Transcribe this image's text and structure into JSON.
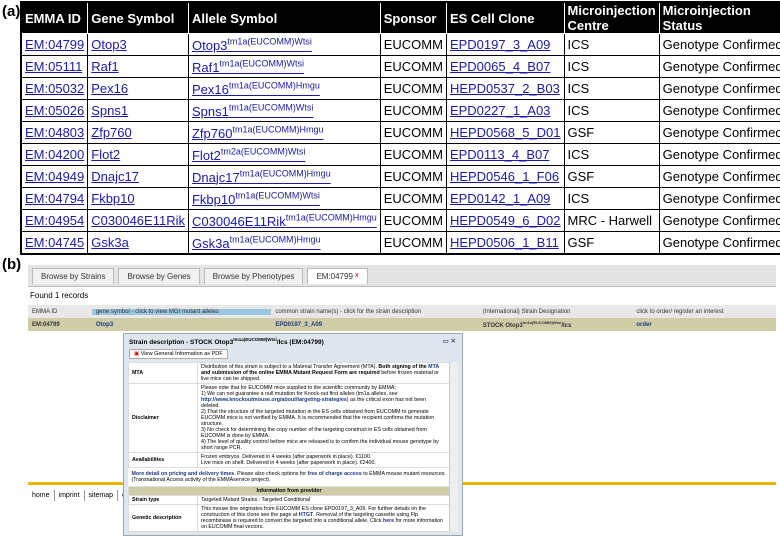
{
  "panel_a": {
    "label": "(a)",
    "headers": [
      "EMMA ID",
      "Gene Symbol",
      "Allele Symbol",
      "Sponsor",
      "ES Cell Clone",
      "Microinjection Centre",
      "Microinjection Status"
    ],
    "rows": [
      [
        "EM:04799",
        "Otop3",
        "Otop3",
        "tm1a(EUCOMM)Wtsi",
        "EUCOMM",
        "EPD0197_3_A09",
        "ICS",
        "Genotype Confirmed"
      ],
      [
        "EM:05111",
        "Raf1",
        "Raf1",
        "tm1a(EUCOMM)Wtsi",
        "EUCOMM",
        "EPD0065_4_B07",
        "ICS",
        "Genotype Confirmed"
      ],
      [
        "EM:05032",
        "Pex16",
        "Pex16",
        "tm1a(EUCOMM)Hmgu",
        "EUCOMM",
        "HEPD0537_2_B03",
        "ICS",
        "Genotype Confirmed"
      ],
      [
        "EM:05026",
        "Spns1",
        "Spns1",
        "tm1a(EUCOMM)Wtsi",
        "EUCOMM",
        "EPD0227_1_A03",
        "ICS",
        "Genotype Confirmed"
      ],
      [
        "EM:04803",
        "Zfp760",
        "Zfp760",
        "tm1a(EUCOMM)Hmgu",
        "EUCOMM",
        "HEPD0568_5_D01",
        "GSF",
        "Genotype Confirmed"
      ],
      [
        "EM:04200",
        "Flot2",
        "Flot2",
        "tm2a(EUCOMM)Wtsi",
        "EUCOMM",
        "EPD0113_4_B07",
        "ICS",
        "Genotype Confirmed"
      ],
      [
        "EM:04949",
        "Dnajc17",
        "Dnajc17",
        "tm1a(EUCOMM)Hmgu",
        "EUCOMM",
        "HEPD0546_1_F06",
        "GSF",
        "Genotype Confirmed"
      ],
      [
        "EM:04794",
        "Fkbp10",
        "Fkbp10",
        "tm1a(EUCOMM)Wtsi",
        "EUCOMM",
        "EPD0142_1_A09",
        "ICS",
        "Genotype Confirmed"
      ],
      [
        "EM:04954",
        "C030046E11Rik",
        "C030046E11Rik",
        "tm1a(EUCOMM)Hmgu",
        "EUCOMM",
        "HEPD0549_6_D02",
        "MRC - Harwell",
        "Genotype Confirmed"
      ],
      [
        "EM:04745",
        "Gsk3a",
        "Gsk3a",
        "tm1a(EUCOMM)Hmgu",
        "EUCOMM",
        "HEPD0506_1_B11",
        "GSF",
        "Genotype Confirmed"
      ]
    ]
  },
  "panel_b": {
    "label": "(b)",
    "tabs": [
      "Browse by Strains",
      "Browse by Genes",
      "Browse by Phenotypes",
      "EM:04799"
    ],
    "close": "x",
    "found": "Found 1 records",
    "grid_headers": [
      "EMMA ID",
      "gene symbol - click to view MGI mutant alleles",
      "common strain name(s) - click for the strain description",
      "(International) Strain Designation",
      "click to order/ register an interest"
    ],
    "grid_row": {
      "id": "EM:04799",
      "gene": "Otop3",
      "clone": "EPD0197_3_A09",
      "desig": "STOCK Otop3",
      "sup": "tm1a(EUCOMM)Wtsi",
      "desig_end": "/Ics",
      "order": "order"
    },
    "popup": {
      "title_a": "Strain description - STOCK Otop3",
      "title_sup": "tm1a(EUCOMM)Wtsi",
      "title_b": "/Ics (EM:04799)",
      "pdf": "View General Information as PDF",
      "mta_k": "MTA",
      "mta_1": "Distribution of this strain is subject to a Material Transfer Agreement (MTA). ",
      "mta_2": "Both signing of the ",
      "mta_3": "MTA",
      "mta_4": " and submission of the online EMMA Mutant Request Form are required",
      "mta_5": " before frozen material or live mice can be shipped.",
      "disc_k": "Disclaimer",
      "disc_1": "Please note that for EUCOMM mice supplied to the scientific community by EMMA:",
      "disc_2": "1) We can not guarantee a null mutation for Knock-out first alleles (tm1a alleles, see ",
      "disc_link": "http://www.knockoutmouse.org/about/targeting-strategies",
      "disc_3": ") as the critical exon has not been deleted.",
      "disc_4": "2) That the structure of the targeted mutation in the ES cells obtained from EUCOMM to generate EUCOMM mice is not verified by EMMA. It is recommended that the recipient confirms the mutation structure.",
      "disc_5": "3) No check for determining the copy number of the targeting construct in ES cells obtained from EUCOMM is done by EMMA.",
      "disc_6": "4) The level of quality control before mice are released is to confirm the individual mouse genotype by short range PCR.",
      "avail_k": "Availabilities",
      "avail_1": "Frozen embryos. Delivered in 4 weeks (after paperwork in place). €1100.",
      "avail_2": "Live mice on shelf. Delivered in 4 weeks (after paperwork in place). €2400.",
      "more_1": "More detail on pricing and delivery times",
      "more_2": ". Please also check options for ",
      "more_3": "free of charge access",
      "more_4": " to EMMA mouse mutant resources (Transnational Access activity of the EMMAservice project).",
      "info": "Information from provider",
      "st_k": "Strain type",
      "st_v": "Targeted Mutant Strains : Targeted Conditional",
      "gd_k": "Genetic description",
      "gd_1": "This mouse line originates from EUCOMM ES clone EPD0197_3_A09. For further details on the construction of this clone see the page at ",
      "gd_2": "HTGT",
      "gd_3": ". Removal of the targeting cassette using Flp recombinase is required to convert the targeted into a conditional allele. Click ",
      "gd_4": "here",
      "gd_5": " for more information on EUCOMM final vectors."
    },
    "footer": [
      "home",
      "imprint",
      "sitemap",
      "c"
    ]
  }
}
